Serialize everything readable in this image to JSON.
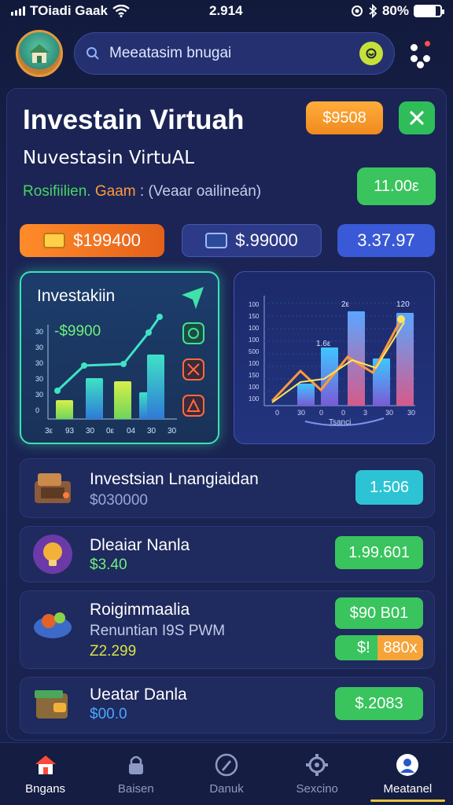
{
  "status_bar": {
    "carrier": "TOiadi Gaak",
    "time": "2.914",
    "battery": "80%",
    "battery_level": 0.8
  },
  "search": {
    "placeholder": "Meeatasim bnugai"
  },
  "hero": {
    "title": "Investain Virtuah",
    "subtitle": "Nuvestasin VirtuAL",
    "desc_green": "Rosifiilien.",
    "desc_orange": "Gaam",
    "desc_rest": ": (Veaar oailineán)",
    "badge_amount": "$9508",
    "rate": "11.00ε"
  },
  "stats": [
    {
      "value": "$199400"
    },
    {
      "value": "$.99000"
    },
    {
      "value": "3.37.97"
    }
  ],
  "chart_left": {
    "title": "Investakiin",
    "value": "-$9900",
    "x_labels": [
      "3ε",
      "93",
      "30",
      "0ε",
      "04",
      "30",
      "30"
    ]
  },
  "chart_right": {
    "top_labels": [
      "2ε",
      "120"
    ],
    "bar_label": "1.6ε",
    "y_labels": [
      "100",
      "150",
      "100",
      "100",
      "500",
      "100",
      "150",
      "100",
      "100"
    ],
    "x_labels": [
      "0",
      "30",
      "0",
      "0",
      "3",
      "30",
      "30"
    ],
    "footer": "Tsanci"
  },
  "list": [
    {
      "title": "Investsian Lnangiaidan",
      "sub": "$030000",
      "tag": "1.506"
    },
    {
      "title": "Dleaiar Nanla",
      "sub": "$3.40",
      "tag": "1.99.601"
    },
    {
      "title": "Roigimmaalia",
      "sub": "Renuntian I9S PWM",
      "value": "Z2.299",
      "tag": "$90 B01",
      "tag2_left": "$!",
      "tag2_right": "880x"
    },
    {
      "title": "Ueatar Danla",
      "sub": "$00.0",
      "tag": "$.2083"
    }
  ],
  "nav": [
    {
      "label": "Bngans"
    },
    {
      "label": "Baisen"
    },
    {
      "label": "Danuk"
    },
    {
      "label": "Sexcino"
    },
    {
      "label": "Meatanel"
    }
  ],
  "colors": {
    "accent_green": "#39c45e",
    "accent_orange": "#f08a1e",
    "accent_blue": "#3a59d6",
    "chart_glow": "#39e3b4"
  }
}
